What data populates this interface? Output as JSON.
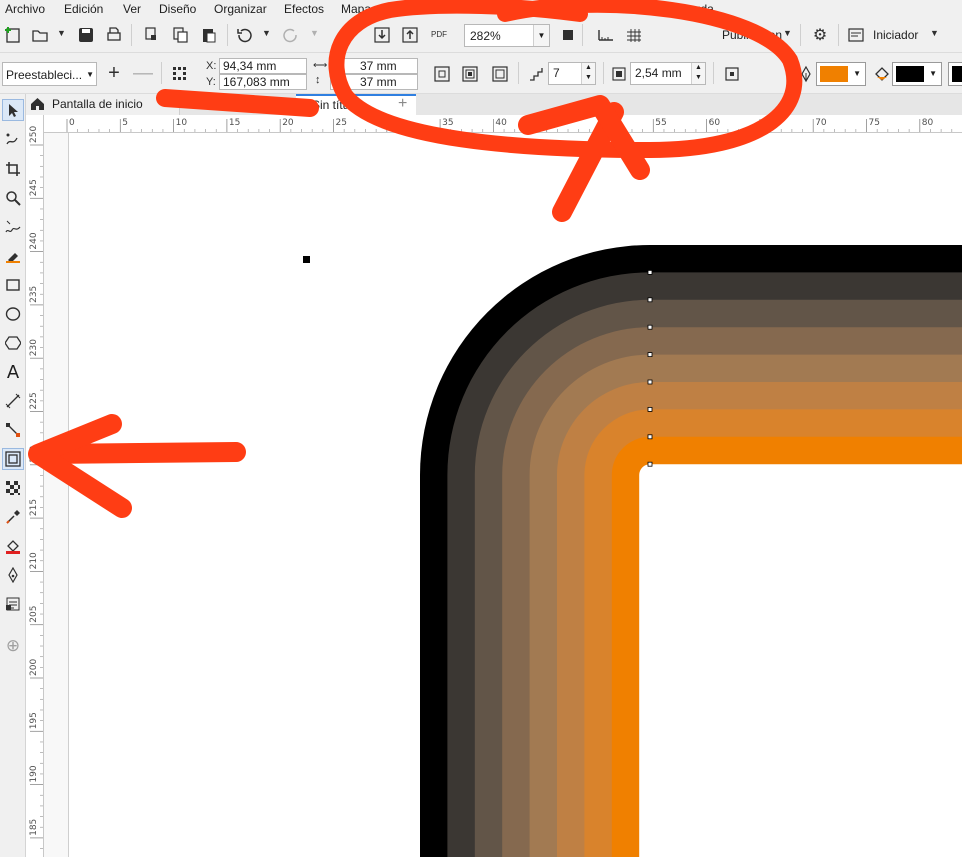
{
  "menu": [
    "Archivo",
    "Edición",
    "Ver",
    "Diseño",
    "Organizar",
    "Efectos",
    "Mapa",
    "Ayuda"
  ],
  "toolbar": {
    "zoom": "282%",
    "export_label": "Publicar en",
    "launcher_label": "Iniciador",
    "pdf_label": "PDF"
  },
  "properties": {
    "preset": "Preestableci...",
    "x_label": "X:",
    "y_label": "Y:",
    "x_value": "94,34 mm",
    "y_value": "167,083 mm",
    "width_value": "37 mm",
    "height_value": "37 mm",
    "steps": "7",
    "offset": "2,54 mm",
    "fill_color": "#f08000",
    "outline_color": "#000000"
  },
  "tabs": {
    "home": "Pantalla de inicio",
    "document": "Sin títul"
  },
  "rulers": {
    "horizontal": [
      "0",
      "5",
      "10",
      "15",
      "20",
      "25",
      "30",
      "35",
      "40",
      "45",
      "50",
      "55",
      "60",
      "65",
      "70",
      "75",
      "80"
    ],
    "vertical": [
      "250",
      "245",
      "240",
      "235",
      "230",
      "225",
      "220",
      "215",
      "210",
      "205",
      "200",
      "195",
      "190",
      "185"
    ]
  },
  "contour_colors": [
    "#000000",
    "#3b3733",
    "#625548",
    "#85694f",
    "#a27a52",
    "#bf8044",
    "#d9832c",
    "#f08000"
  ],
  "annotation_color": "#ff3d14",
  "tools": [
    "pointer-icon",
    "freehand-shape-icon",
    "crop-icon",
    "zoom-icon",
    "curve-icon",
    "fill-artistic-icon",
    "rectangle-icon",
    "ellipse-icon",
    "polygon-icon",
    "text-icon",
    "dimension-icon",
    "connector-icon",
    "contour-icon",
    "transparency-icon",
    "eyedropper-icon",
    "interactive-fill-icon",
    "pen-outline-icon",
    "smart-fill-icon",
    "add-tool-icon"
  ]
}
